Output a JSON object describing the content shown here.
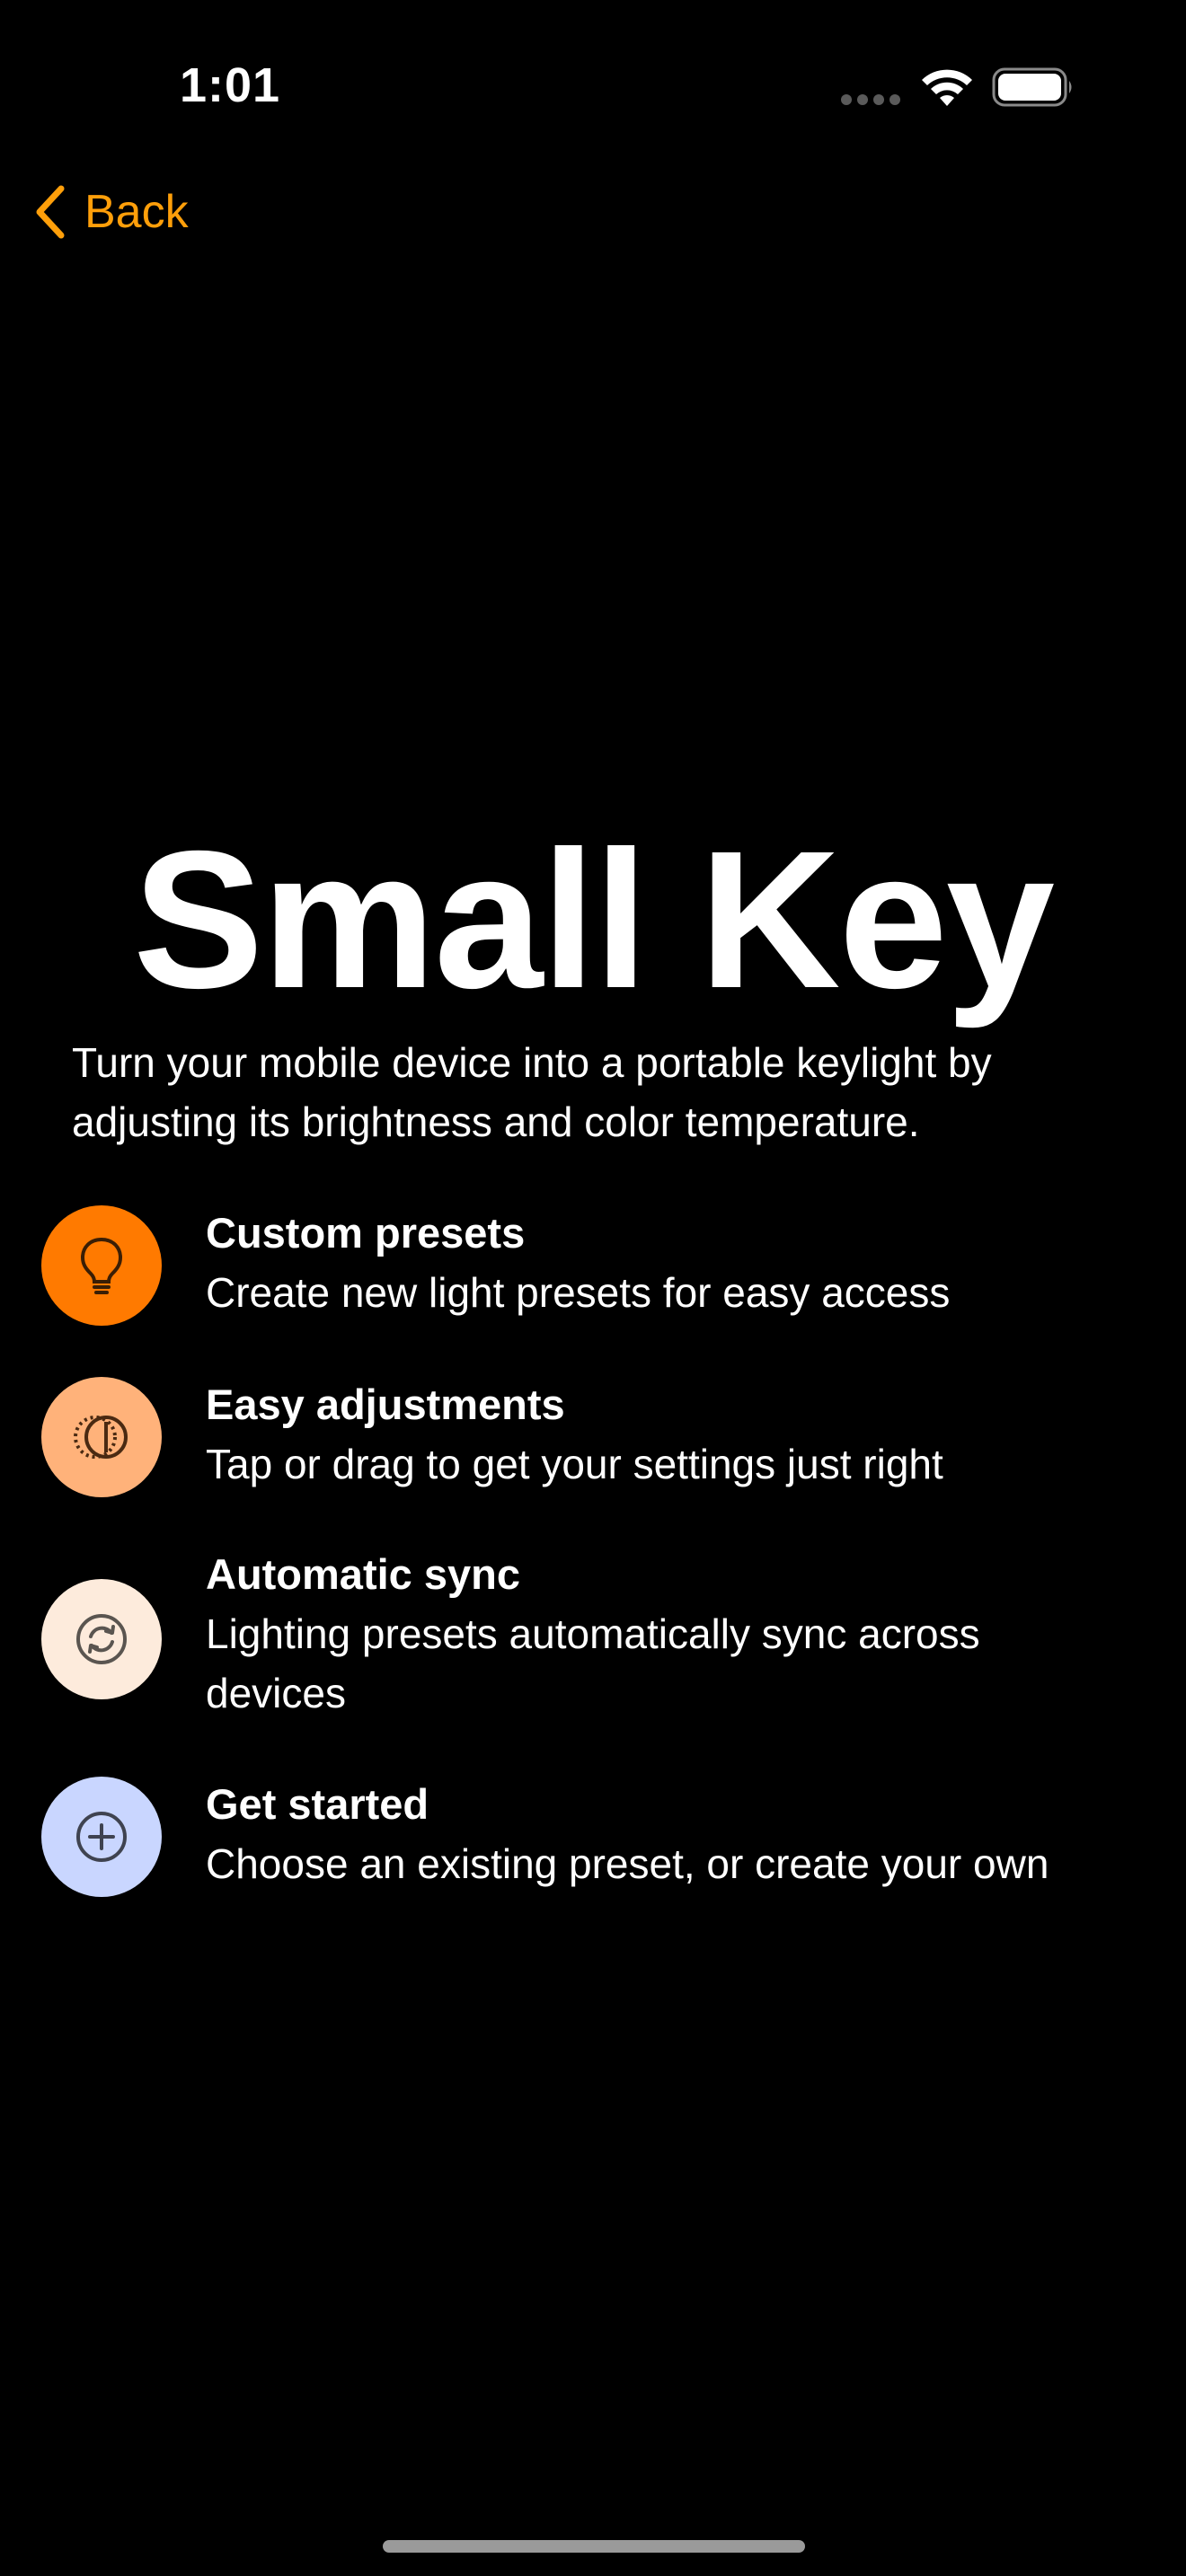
{
  "status_bar": {
    "time": "1:01"
  },
  "nav": {
    "back_label": "Back",
    "accent_color": "#FF9F0A"
  },
  "hero": {
    "title": "Small Key",
    "description": "Turn your mobile device into a portable keylight by adjusting its brightness and color temperature."
  },
  "features": [
    {
      "title": "Custom presets",
      "description": "Create new light presets for easy access",
      "icon": "lightbulb-icon",
      "icon_bg": "#FF7A00"
    },
    {
      "title": "Easy adjustments",
      "description": "Tap or drag to get your settings just right",
      "icon": "dial-adjust-icon",
      "icon_bg": "#FFB27A"
    },
    {
      "title": "Automatic sync",
      "description": "Lighting presets automatically sync across devices",
      "icon": "sync-arrows-icon",
      "icon_bg": "#FDEBDC"
    },
    {
      "title": "Get started",
      "description": "Choose an existing preset, or create your own",
      "icon": "plus-circle-icon",
      "icon_bg": "#C9D6FF"
    }
  ]
}
